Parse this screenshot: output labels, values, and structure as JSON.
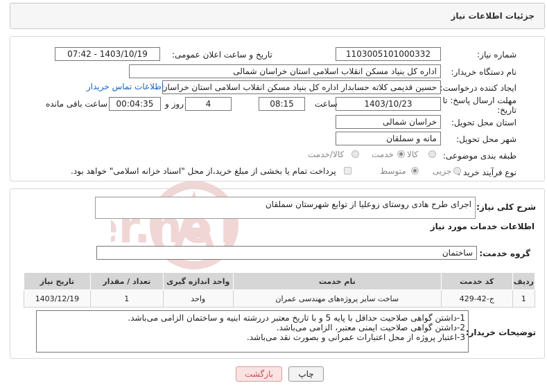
{
  "header": {
    "title": "جزئیات اطلاعات نیاز"
  },
  "form": {
    "need_number_label": "شماره نیاز:",
    "need_number": "1103005101000332",
    "announce_label": "تاریخ و ساعت اعلان عمومی:",
    "announce_value": "1403/10/19 - 07:42",
    "buyer_org_label": "نام دستگاه خریدار:",
    "buyer_org": "اداره کل بنیاد مسکن انقلاب اسلامی استان خراسان شمالی",
    "creator_label": "ایجاد کننده درخواست:",
    "creator": "حسین قدیمی کلاته حسابدار اداره کل بنیاد مسکن انقلاب اسلامی استان خراسان شمالی",
    "contact_link": "اطلاعات تماس خریدار",
    "deadline_label_1": "مهلت ارسال پاسخ: تا",
    "deadline_label_2": "تاریخ:",
    "deadline_date": "1403/10/23",
    "time_label": "ساعت",
    "deadline_time": "08:15",
    "days_value": "4",
    "days_label": "روز و",
    "remaining_value": "00:04:35",
    "remaining_label": "ساعت باقی مانده",
    "province_label": "استان محل تحویل:",
    "province": "خراسان شمالی",
    "city_label": "شهر محل تحویل:",
    "city": "مانه و سملقان",
    "category_label": "طبقه بندی موضوعی:",
    "category_options": [
      "کالا",
      "خدمت",
      "کالا/خدمت"
    ],
    "category_selected": "خدمت",
    "process_label": "نوع فرآیند خرید :",
    "process_options": [
      "جزیی",
      "متوسط"
    ],
    "process_selected": "متوسط",
    "treasury_note": "پرداخت تمام یا بخشی از مبلغ خرید،از محل \"اسناد خزانه اسلامی\" خواهد بود."
  },
  "summary": {
    "label": "شرح کلی نیاز:",
    "text": "اجرای طرح هادی روستای زوعلیا از توابع شهرستان سملقان"
  },
  "services": {
    "section_title": "اطلاعات خدمات مورد نیاز",
    "group_label": "گروه خدمت:",
    "group_value": "ساختمان",
    "columns": [
      "ردیف",
      "کد خدمت",
      "نام خدمت",
      "واحد اندازه گیری",
      "تعداد / مقدار",
      "تاریخ نیاز"
    ],
    "rows": [
      [
        "1",
        "ج-42-429",
        "ساخت سایر پروژه‌های مهندسی عمران",
        "واحد",
        "1",
        "1403/12/19"
      ]
    ]
  },
  "buyer_notes": {
    "label": "توضیحات خریدار:",
    "lines": [
      "1-داشتن گواهی صلاحیت حداقل با پایه 5 و با تاریخ معتبر دررشته ابنیه و ساختمان الزامی می‌باشد.",
      "2-داشتن گواهی صلاحیت ایمنی معتبر، الزامی می‌باشد.",
      "3-اعتبار پروژه از محل اعتبارات عمرانی و بصورت نقد می‌باشد."
    ]
  },
  "buttons": {
    "print": "چاپ",
    "back": "بازگشت"
  },
  "watermark": {
    "text": "AriaTender.neT",
    "color": "#e8b4b4"
  }
}
